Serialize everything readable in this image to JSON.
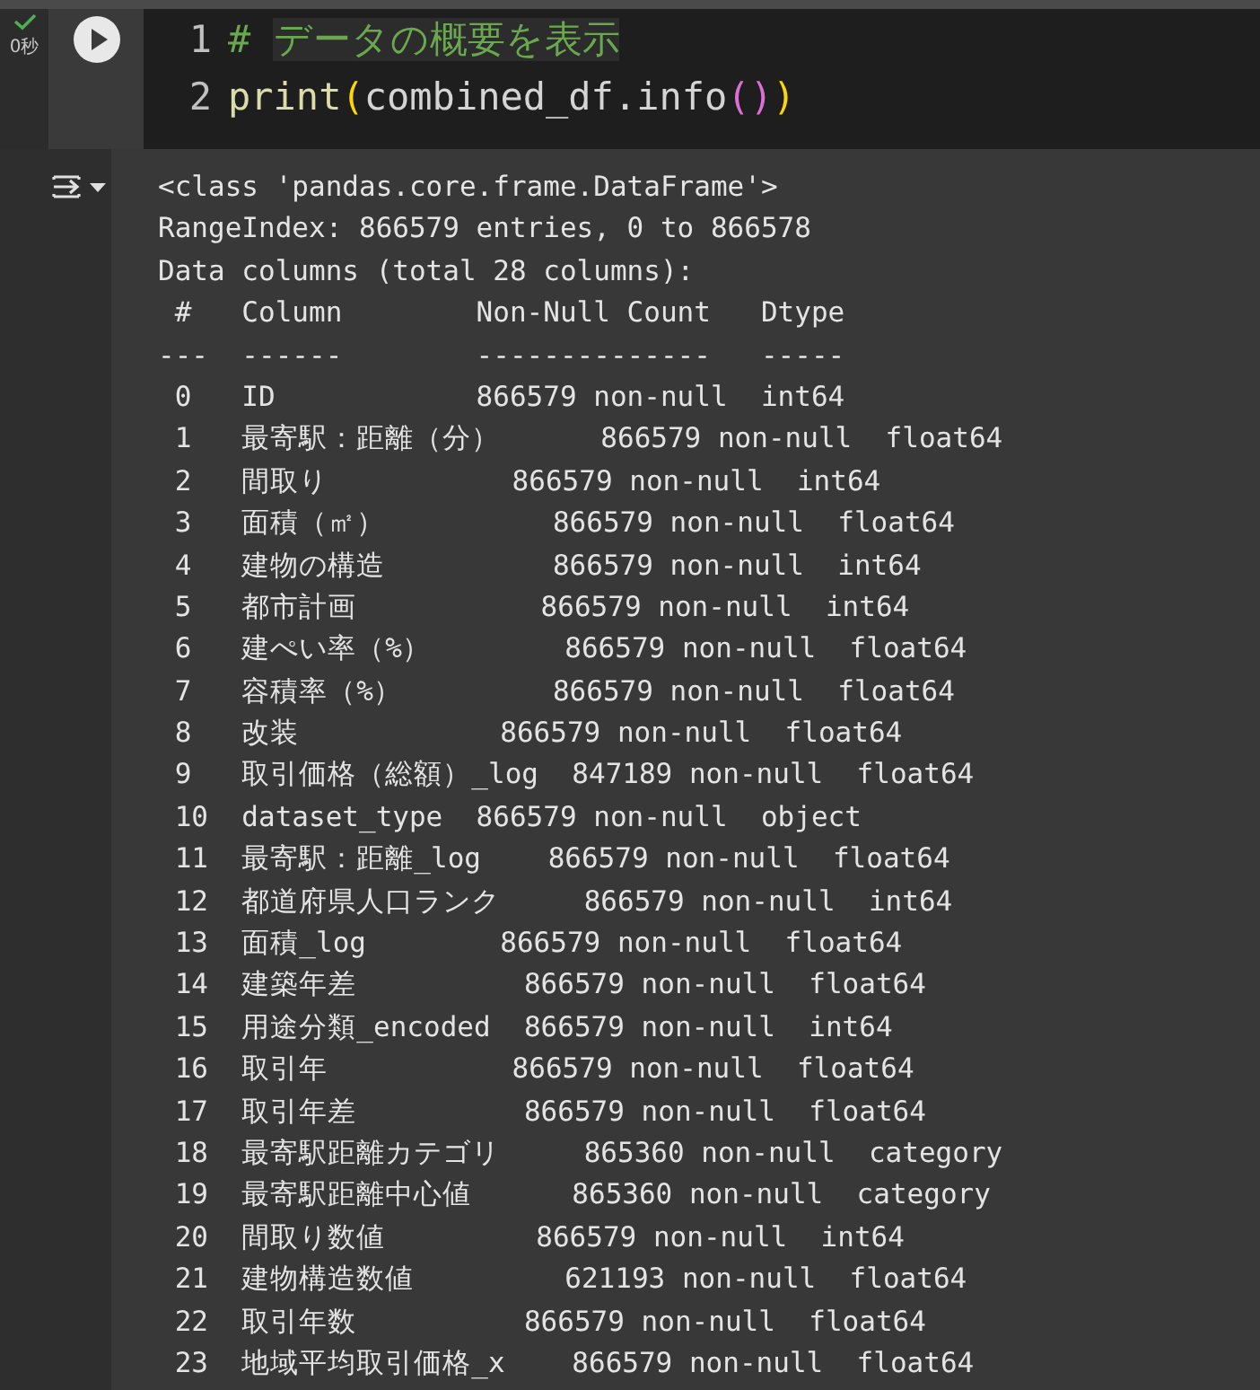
{
  "cell": {
    "run_status": "0秒",
    "succeeded": true,
    "code_lines": [
      {
        "number": "1",
        "tokens": [
          {
            "kind": "comment",
            "text": "# "
          },
          {
            "kind": "comment_highlight",
            "text": "データの概要を表示"
          }
        ]
      },
      {
        "number": "2",
        "tokens": [
          {
            "kind": "builtin",
            "text": "print"
          },
          {
            "kind": "paren_outer",
            "text": "("
          },
          {
            "kind": "plain",
            "text": "combined_df.info"
          },
          {
            "kind": "paren_inner",
            "text": "()"
          },
          {
            "kind": "paren_outer",
            "text": ")"
          }
        ]
      }
    ],
    "output_lines": [
      "<class 'pandas.core.frame.DataFrame'>",
      "RangeIndex: 866579 entries, 0 to 866578",
      "Data columns (total 28 columns):",
      " #   Column        Non-Null Count   Dtype",
      "---  ------        --------------   -----",
      " 0   ID            866579 non-null  int64",
      " 1   最寄駅：距離（分）      866579 non-null  float64",
      " 2   間取り           866579 non-null  int64",
      " 3   面積（㎡）          866579 non-null  float64",
      " 4   建物の構造          866579 non-null  int64",
      " 5   都市計画           866579 non-null  int64",
      " 6   建ぺい率（%）        866579 non-null  float64",
      " 7   容積率（%）         866579 non-null  float64",
      " 8   改装            866579 non-null  float64",
      " 9   取引価格（総額）_log  847189 non-null  float64",
      " 10  dataset_type  866579 non-null  object",
      " 11  最寄駅：距離_log    866579 non-null  float64",
      " 12  都道府県人口ランク     866579 non-null  int64",
      " 13  面積_log        866579 non-null  float64",
      " 14  建築年差          866579 non-null  float64",
      " 15  用途分類_encoded  866579 non-null  int64",
      " 16  取引年           866579 non-null  float64",
      " 17  取引年差          866579 non-null  float64",
      " 18  最寄駅距離カテゴリ     865360 non-null  category",
      " 19  最寄駅距離中心値      865360 non-null  category",
      " 20  間取り数値         866579 non-null  int64",
      " 21  建物構造数値         621193 non-null  float64",
      " 22  取引年数          866579 non-null  float64",
      " 23  地域平均取引価格_x    866579 non-null  float64"
    ]
  }
}
